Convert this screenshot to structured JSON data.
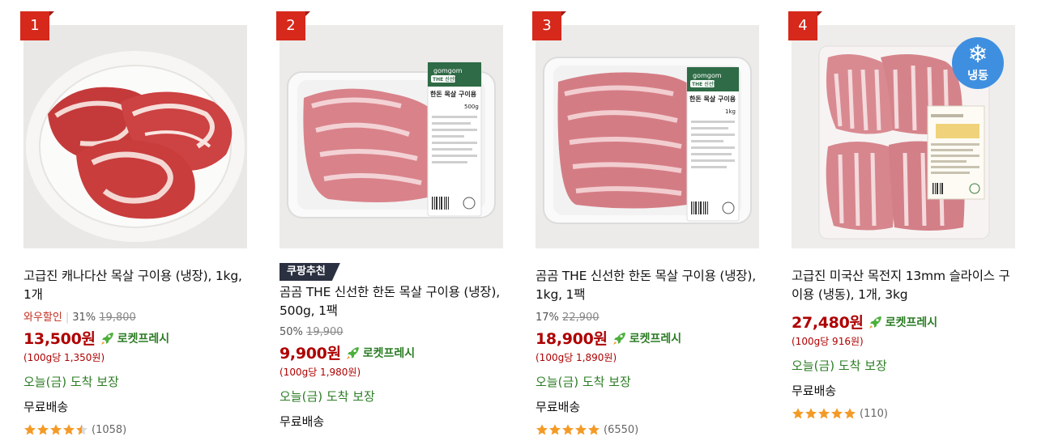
{
  "products": [
    {
      "rank": "1",
      "badge": "",
      "name": "고급진 캐나다산 목살 구이용 (냉장), 1kg, 1개",
      "wow_label": "와우할인",
      "discount_rate": "31%",
      "original_price": "19,800",
      "price": "13,500원",
      "rocket_label": "로켓프레시",
      "unit_price": "(100g당 1,350원)",
      "delivery": "오늘(금) 도착 보장",
      "shipping": "무료배송",
      "rating": 4.5,
      "review_count": "(1058)"
    },
    {
      "rank": "2",
      "badge": "쿠팡추천",
      "name": "곰곰 THE 신선한 한돈 목살 구이용 (냉장), 500g, 1팩",
      "wow_label": "",
      "discount_rate": "50%",
      "original_price": "19,900",
      "price": "9,900원",
      "rocket_label": "로켓프레시",
      "unit_price": "(100g당 1,980원)",
      "delivery": "오늘(금) 도착 보장",
      "shipping": "무료배송",
      "rating": null,
      "review_count": ""
    },
    {
      "rank": "3",
      "badge": "",
      "name": "곰곰 THE 신선한 한돈 목살 구이용 (냉장), 1kg, 1팩",
      "wow_label": "",
      "discount_rate": "17%",
      "original_price": "22,900",
      "price": "18,900원",
      "rocket_label": "로켓프레시",
      "unit_price": "(100g당 1,890원)",
      "delivery": "오늘(금) 도착 보장",
      "shipping": "무료배송",
      "rating": 5,
      "review_count": "(6550)"
    },
    {
      "rank": "4",
      "badge": "",
      "frozen_label": "냉동",
      "name": "고급진 미국산 목전지 13mm 슬라이스 구이용 (냉동), 1개, 3kg",
      "wow_label": "",
      "discount_rate": "",
      "original_price": "",
      "price": "27,480원",
      "rocket_label": "로켓프레시",
      "unit_price": "(100g당 916원)",
      "delivery": "오늘(금) 도착 보장",
      "shipping": "무료배송",
      "rating": 5,
      "review_count": "(110)"
    }
  ],
  "product_images": [
    {
      "type": "plate",
      "pack_brand": ""
    },
    {
      "type": "tray",
      "pack_brand": "gomgom",
      "pack_title": "THE 신선한",
      "pack_subtitle": "한돈 목살 구이용",
      "pack_weight": "500g"
    },
    {
      "type": "tray",
      "pack_brand": "gomgom",
      "pack_title": "THE 신선한",
      "pack_subtitle": "한돈 목살 구이용",
      "pack_weight": "1kg"
    },
    {
      "type": "vacuum",
      "pack_brand": ""
    }
  ],
  "colors": {
    "rank_bg": "#d6281b",
    "price": "#ae0000",
    "rocket": "#2c7d25",
    "star": "#f49a26",
    "badge_bg": "#2b3140",
    "frozen_badge": "#3f8fe0"
  }
}
